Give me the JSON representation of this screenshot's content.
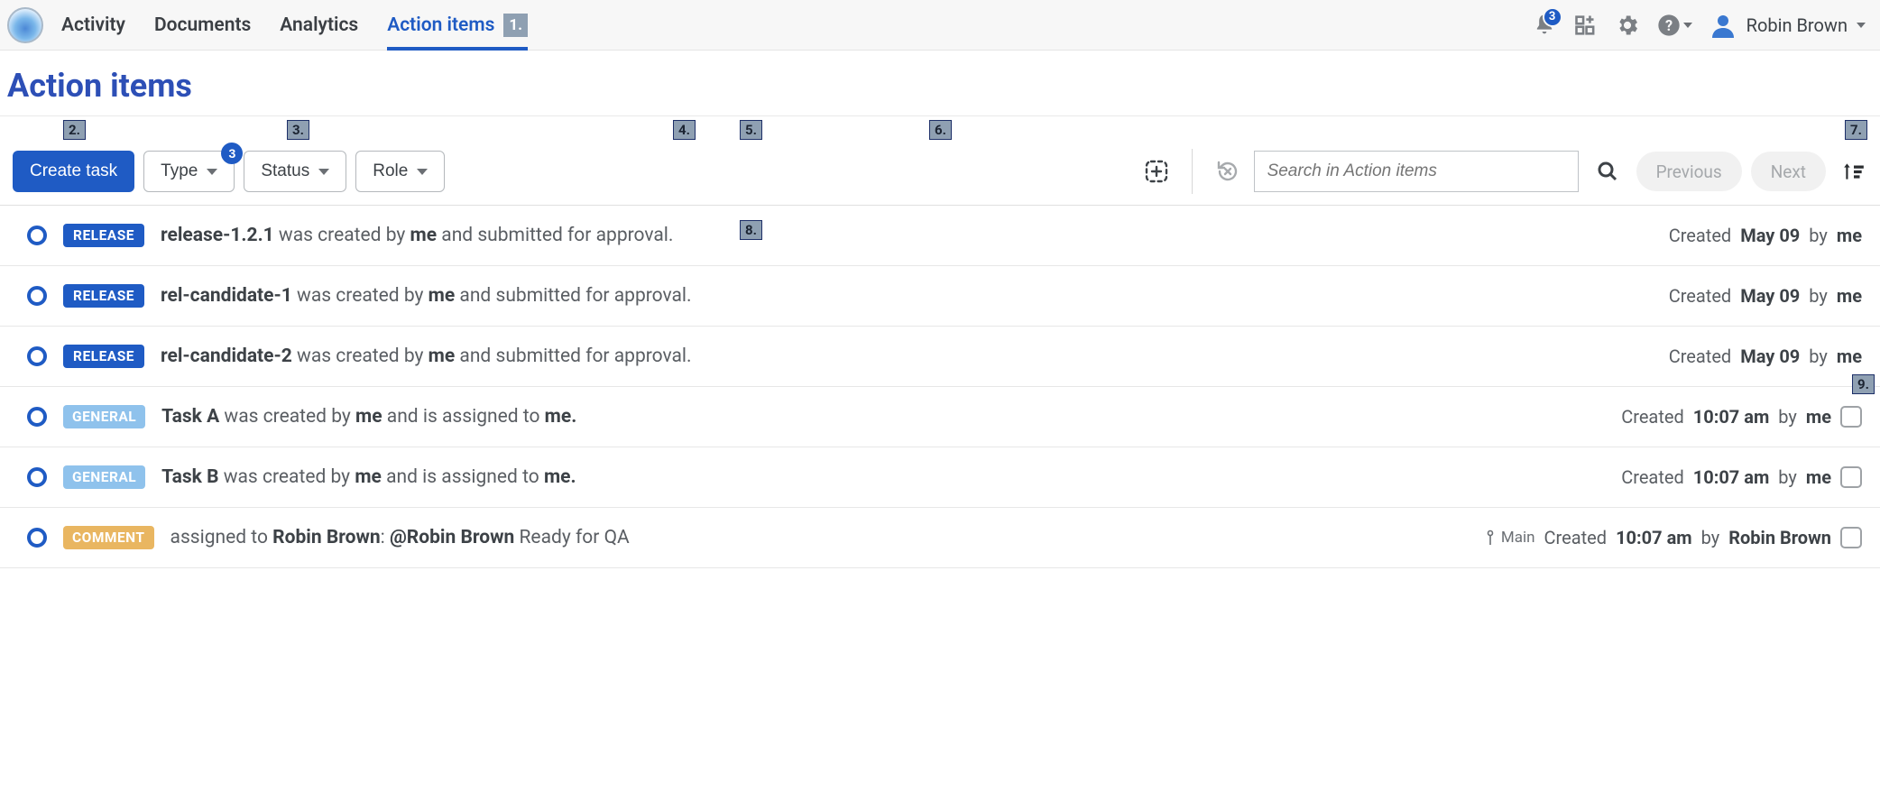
{
  "nav": {
    "tabs": [
      "Activity",
      "Documents",
      "Analytics",
      "Action items"
    ],
    "active_index": 3,
    "active_count": "1."
  },
  "notifications_count": "3",
  "user_name": "Robin Brown",
  "page_title": "Action items",
  "toolbar": {
    "create_label": "Create task",
    "filters": {
      "type": {
        "label": "Type",
        "badge": "3"
      },
      "status": {
        "label": "Status"
      },
      "role": {
        "label": "Role"
      }
    },
    "search_placeholder": "Search in Action items",
    "prev_label": "Previous",
    "next_label": "Next"
  },
  "annotations": {
    "a2": "2.",
    "a3": "3.",
    "a4": "4.",
    "a5": "5.",
    "a6": "6.",
    "a7": "7.",
    "a8": "8.",
    "a9": "9."
  },
  "rows": [
    {
      "tag": "RELEASE",
      "tag_class": "tag-release",
      "subject": "release-1.2.1",
      "mid": " was created by ",
      "actor": "me",
      "suffix": " and submitted for approval.",
      "meta_prefix": "Created ",
      "meta_time": "May 09",
      "meta_by": " by ",
      "meta_actor": "me",
      "checkbox": false,
      "branch": null
    },
    {
      "tag": "RELEASE",
      "tag_class": "tag-release",
      "subject": "rel-candidate-1",
      "mid": " was created by ",
      "actor": "me",
      "suffix": " and submitted for approval.",
      "meta_prefix": "Created ",
      "meta_time": "May 09",
      "meta_by": " by ",
      "meta_actor": "me",
      "checkbox": false,
      "branch": null
    },
    {
      "tag": "RELEASE",
      "tag_class": "tag-release",
      "subject": "rel-candidate-2",
      "mid": " was created by ",
      "actor": "me",
      "suffix": " and submitted for approval.",
      "meta_prefix": "Created ",
      "meta_time": "May 09",
      "meta_by": " by ",
      "meta_actor": "me",
      "checkbox": false,
      "branch": null
    },
    {
      "tag": "GENERAL",
      "tag_class": "tag-general",
      "subject": "Task A",
      "mid": " was created by ",
      "actor": "me",
      "suffix_pre": " and is assigned to ",
      "actor2": "me.",
      "suffix": "",
      "meta_prefix": "Created ",
      "meta_time": "10:07 am",
      "meta_by": " by ",
      "meta_actor": "me",
      "checkbox": true,
      "branch": null
    },
    {
      "tag": "GENERAL",
      "tag_class": "tag-general",
      "subject": "Task B",
      "mid": " was created by ",
      "actor": "me",
      "suffix_pre": " and is assigned to ",
      "actor2": "me.",
      "suffix": "",
      "meta_prefix": "Created ",
      "meta_time": "10:07 am",
      "meta_by": " by ",
      "meta_actor": "me",
      "checkbox": true,
      "branch": null
    },
    {
      "tag": "COMMENT",
      "tag_class": "tag-comment",
      "prefix": "assigned to ",
      "subject": "Robin Brown",
      "colon": ":   ",
      "mention": "@Robin Brown",
      "suffix": " Ready for QA",
      "meta_prefix": "Created ",
      "meta_time": "10:07 am",
      "meta_by": " by ",
      "meta_actor": "Robin Brown",
      "checkbox": true,
      "branch": "Main"
    }
  ]
}
